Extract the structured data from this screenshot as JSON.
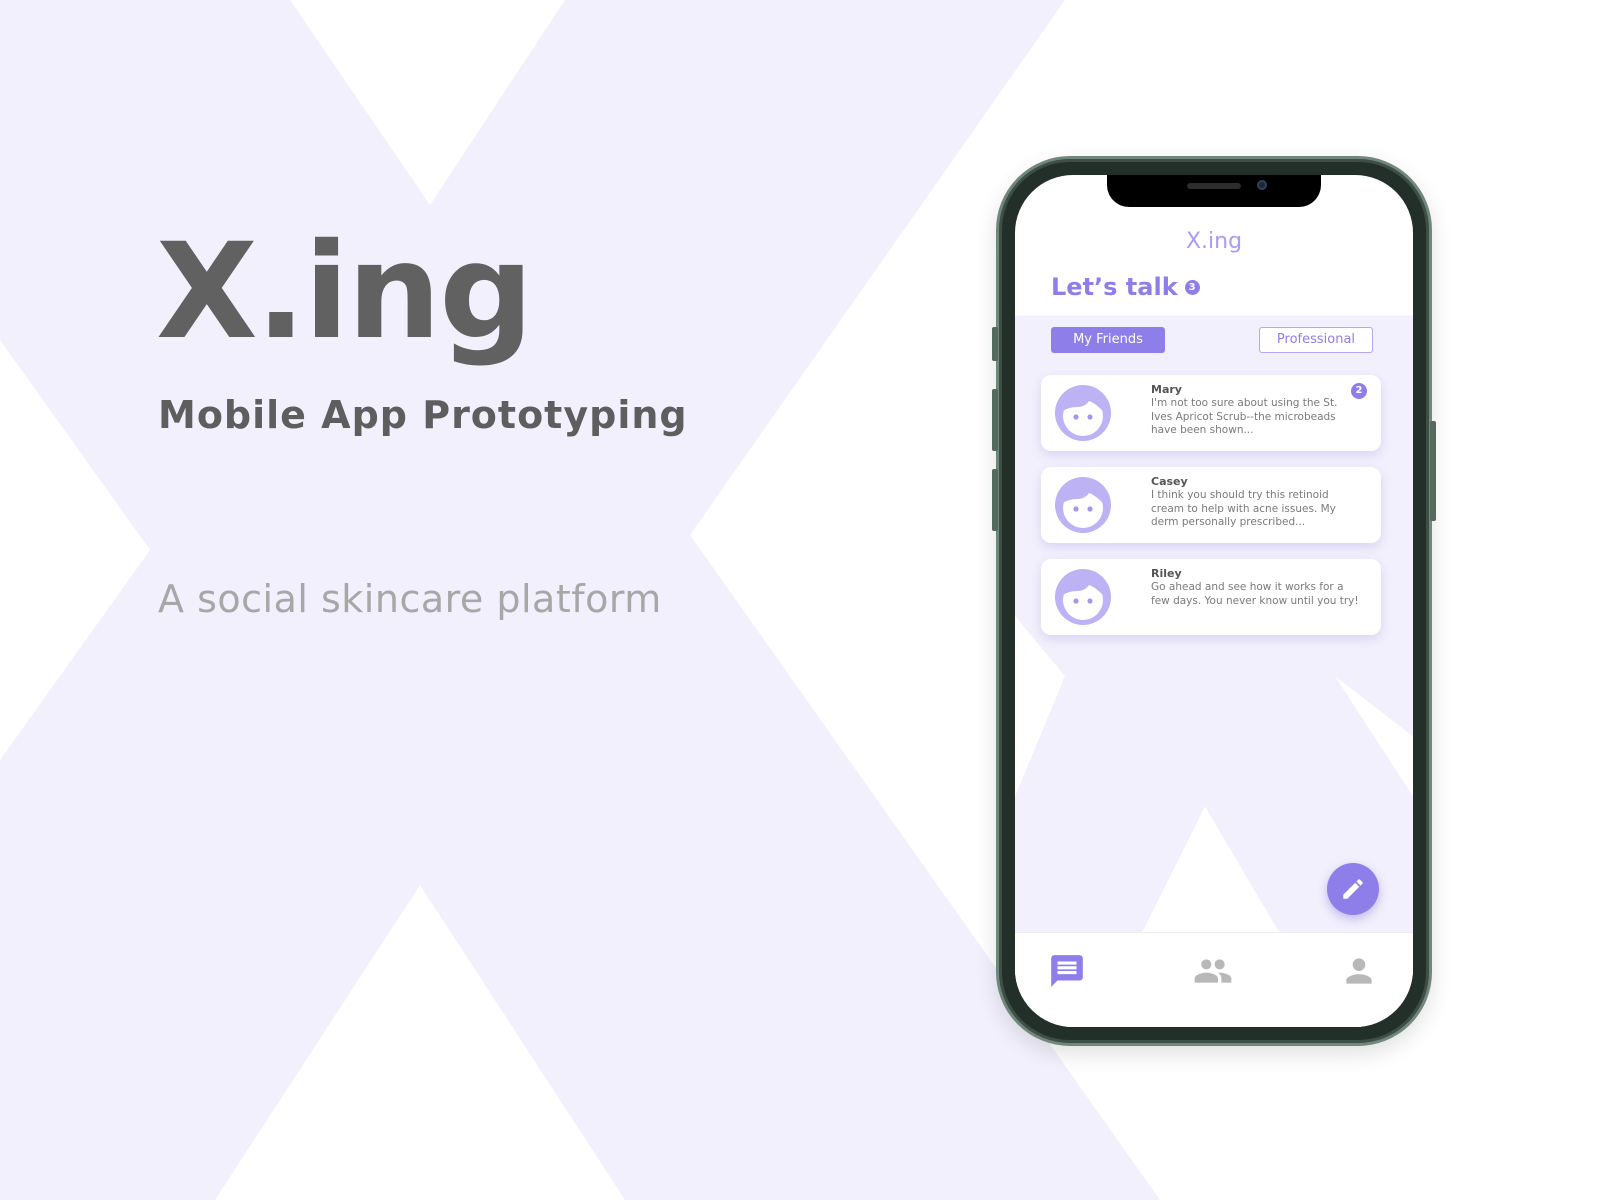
{
  "hero": {
    "title": "X.ing",
    "subtitle": "Mobile App Prototyping",
    "tagline": "A social skincare platform"
  },
  "app": {
    "title": "X.ing",
    "section_title": "Let’s talk",
    "unread_total": "3",
    "tabs": [
      {
        "label": "My Friends",
        "active": true
      },
      {
        "label": "Professional",
        "active": false
      }
    ],
    "conversations": [
      {
        "name": "Mary",
        "preview": "I'm not too sure about using the St. Ives Apricot Scrub--the microbeads have been shown...",
        "unread": "2"
      },
      {
        "name": "Casey",
        "preview": "I think you should try this retinoid cream to help with acne issues. My derm personally prescribed...",
        "unread": ""
      },
      {
        "name": "Riley",
        "preview": "Go ahead and see how it works for a few days. You never know until you try!",
        "unread": ""
      }
    ],
    "fab_icon": "pencil-icon",
    "bottom_nav": [
      {
        "icon": "chat-icon",
        "active": true
      },
      {
        "icon": "people-icon",
        "active": false
      },
      {
        "icon": "person-icon",
        "active": false
      }
    ]
  },
  "colors": {
    "accent": "#8e7ee9",
    "background_shape": "#f2f0fc",
    "hero_text": "#616161",
    "tagline_text": "#a7a7a7",
    "inactive_icon": "#b8b8b8"
  }
}
